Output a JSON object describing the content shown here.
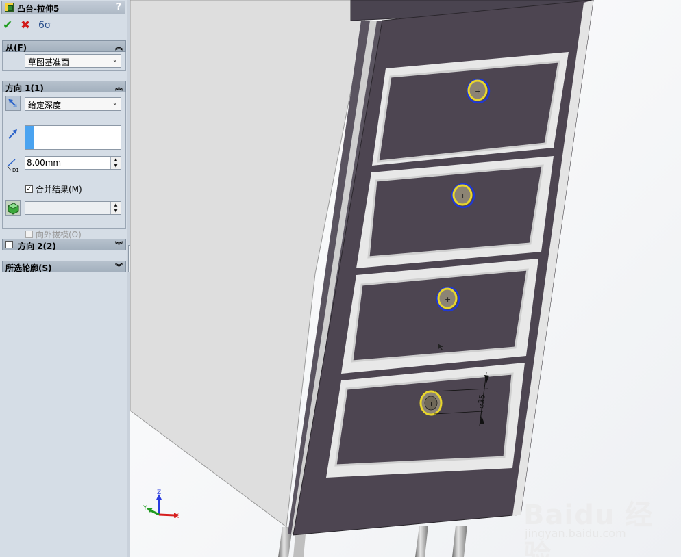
{
  "feature_manager": {
    "title": "凸台-拉伸5",
    "help": "?",
    "actions": {
      "ok": "✔",
      "cancel": "✖",
      "preview": "6σ"
    }
  },
  "from_group": {
    "title": "从(F)",
    "start_condition": "草图基准面"
  },
  "direction1": {
    "title": "方向 1(1)",
    "end_condition": "给定深度",
    "depth": "8.00mm",
    "merge_result_label": "合并结果(M)",
    "merge_result_checked": true,
    "draft_outward_label": "向外拔模(O)"
  },
  "direction2": {
    "title": "方向 2(2)"
  },
  "selected_contours": {
    "title": "所选轮廓(S)"
  },
  "viewport": {
    "dimension_label": "⌀35",
    "triad": {
      "x": "X",
      "y": "Y",
      "z": "Z"
    }
  },
  "watermark": {
    "brand": "Baidu 经验",
    "url": "jingyan.baidu.com"
  },
  "colors": {
    "panel_bg": "#d5dde6",
    "model_face": "#4d4551",
    "model_side": "#dcdcdc",
    "highlight_blue": "#1f38d6",
    "highlight_yellow": "#e8d62c"
  }
}
